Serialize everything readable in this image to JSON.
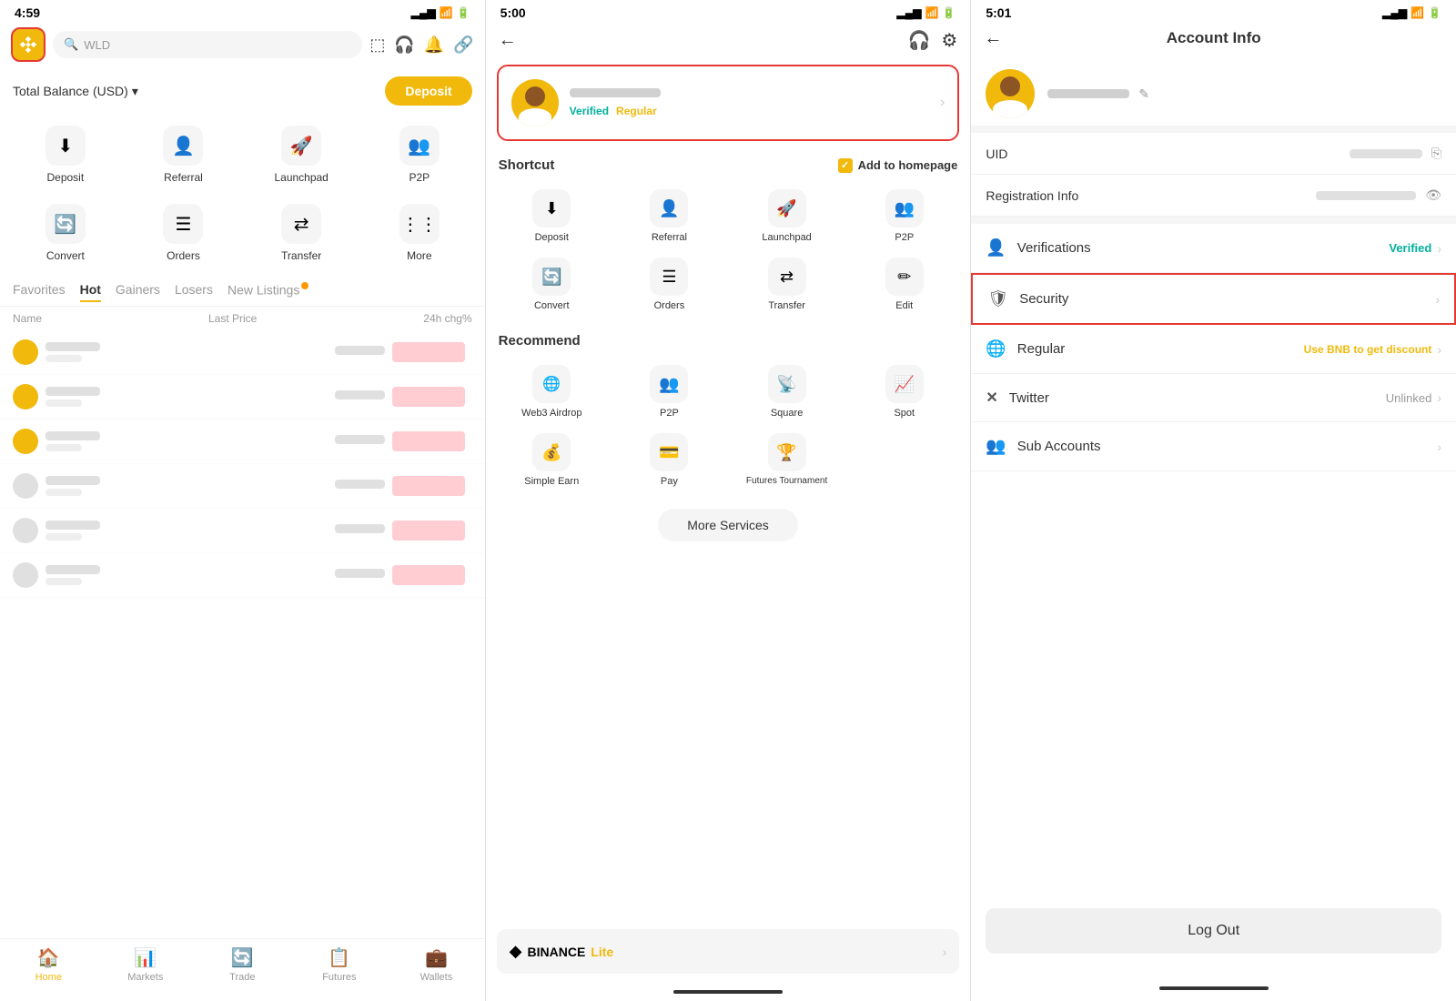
{
  "phone1": {
    "status_time": "4:59",
    "logo_emoji": "◆",
    "search_placeholder": "WLD",
    "balance_label": "Total Balance (USD)",
    "deposit_btn": "Deposit",
    "grid_items": [
      {
        "icon": "⬇",
        "label": "Deposit"
      },
      {
        "icon": "👤+",
        "label": "Referral"
      },
      {
        "icon": "🚀",
        "label": "Launchpad"
      },
      {
        "icon": "👥",
        "label": "P2P"
      },
      {
        "icon": "🔄",
        "label": "Convert"
      },
      {
        "icon": "≡",
        "label": "Orders"
      },
      {
        "icon": "⇄",
        "label": "Transfer"
      },
      {
        "icon": "⋮⋮",
        "label": "More"
      }
    ],
    "tabs": [
      "Favorites",
      "Hot",
      "Gainers",
      "Losers",
      "New Listings"
    ],
    "active_tab": "Hot",
    "table_headers": [
      "Name",
      "Last Price",
      "24h chg%"
    ],
    "nav_items": [
      {
        "icon": "🏠",
        "label": "Home"
      },
      {
        "icon": "📊",
        "label": "Markets"
      },
      {
        "icon": "🔄",
        "label": "Trade"
      },
      {
        "icon": "📋",
        "label": "Futures"
      },
      {
        "icon": "💼",
        "label": "Wallets"
      }
    ],
    "active_nav": "Home"
  },
  "phone2": {
    "status_time": "5:00",
    "profile_name_hidden": true,
    "verified_label": "Verified",
    "regular_label": "Regular",
    "shortcut_section": "Shortcut",
    "add_to_homepage": "Add to homepage",
    "shortcut_items": [
      {
        "icon": "⬇",
        "label": "Deposit"
      },
      {
        "icon": "👤+",
        "label": "Referral"
      },
      {
        "icon": "🚀",
        "label": "Launchpad"
      },
      {
        "icon": "👥",
        "label": "P2P"
      },
      {
        "icon": "🔄",
        "label": "Convert"
      },
      {
        "icon": "≡",
        "label": "Orders"
      },
      {
        "icon": "⇄",
        "label": "Transfer"
      },
      {
        "icon": "✏",
        "label": "Edit"
      }
    ],
    "recommend_section": "Recommend",
    "recommend_items": [
      {
        "icon": "🌐",
        "label": "Web3 Airdrop"
      },
      {
        "icon": "👥",
        "label": "P2P"
      },
      {
        "icon": "📡",
        "label": "Square"
      },
      {
        "icon": "📈",
        "label": "Spot"
      },
      {
        "icon": "💰",
        "label": "Simple Earn"
      },
      {
        "icon": "💳",
        "label": "Pay"
      },
      {
        "icon": "🏆",
        "label": "Futures\nTournament"
      }
    ],
    "more_services_btn": "More Services",
    "binance_lite": "BINANCE",
    "binance_lite_suffix": "Lite"
  },
  "phone3": {
    "status_time": "5:01",
    "page_title": "Account Info",
    "uid_label": "UID",
    "reg_info_label": "Registration Info",
    "verifications_label": "Verifications",
    "verified_status": "Verified",
    "security_label": "Security",
    "regular_label": "Regular",
    "regular_action": "Use BNB to get discount",
    "twitter_label": "Twitter",
    "twitter_status": "Unlinked",
    "sub_accounts_label": "Sub Accounts",
    "logout_btn": "Log Out"
  }
}
